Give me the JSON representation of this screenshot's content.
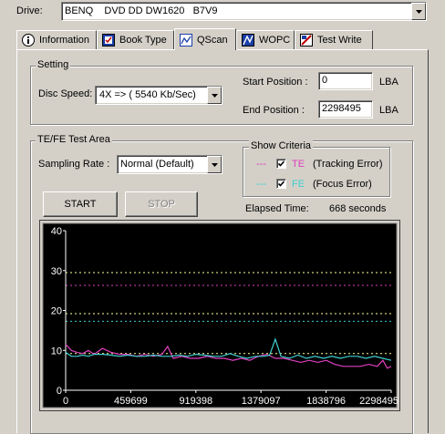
{
  "drive": {
    "label": "Drive:",
    "value": "BENQ    DVD DD DW1620   B7V9"
  },
  "tabs": [
    {
      "label": "Information",
      "icon": "info-icon"
    },
    {
      "label": "Book Type",
      "icon": "book-type-icon"
    },
    {
      "label": "QScan",
      "icon": "qscan-icon",
      "active": true
    },
    {
      "label": "WOPC",
      "icon": "wopc-icon"
    },
    {
      "label": "Test Write",
      "icon": "test-write-icon"
    }
  ],
  "setting": {
    "title": "Setting",
    "disc_speed_label": "Disc Speed:",
    "disc_speed_value": "4X => ( 5540 Kb/Sec)",
    "start_label": "Start Position :",
    "start_value": "0",
    "start_unit": "LBA",
    "end_label": "End Position :",
    "end_value": "2298495",
    "end_unit": "LBA"
  },
  "tefe": {
    "title": "TE/FE Test Area",
    "sampling_label": "Sampling Rate :",
    "sampling_value": "Normal (Default)",
    "show_criteria_title": "Show Criteria",
    "te_dash": "---",
    "te_abbr": "TE",
    "te_desc": "(Tracking Error)",
    "te_checked": true,
    "fe_dash": "---",
    "fe_abbr": "FE",
    "fe_desc": "(Focus Error)",
    "fe_checked": true,
    "start_button": "START",
    "stop_button": "STOP",
    "elapsed_label": "Elapsed Time:",
    "elapsed_value": "668 seconds"
  },
  "colors": {
    "te": "#e040c0",
    "fe": "#40d0d0",
    "plot_bg": "#000000",
    "threshold_white": "#ffff99"
  },
  "chart_data": {
    "type": "line",
    "title": "",
    "xlabel": "",
    "ylabel": "",
    "xlim": [
      0,
      2298495
    ],
    "ylim": [
      0,
      40
    ],
    "y_ticks": [
      "0",
      "10",
      "20",
      "30",
      "40"
    ],
    "x_ticks": [
      "0",
      "459699",
      "919398",
      "1379097",
      "1838796",
      "2298495"
    ],
    "x_tick_values": [
      0,
      459699,
      919398,
      1379097,
      1838796,
      2298495
    ],
    "threshold_lines": [
      {
        "color": "white",
        "y": 29.5
      },
      {
        "color": "te",
        "y": 26.3
      },
      {
        "color": "white",
        "y": 19.2
      },
      {
        "color": "fe",
        "y": 17.3
      },
      {
        "color": "white",
        "y": 9.2
      }
    ],
    "series": [
      {
        "key": "te",
        "x": [
          0,
          40000,
          80000,
          120000,
          160000,
          200000,
          260000,
          320000,
          380000,
          440000,
          500000,
          560000,
          620000,
          680000,
          720000,
          760000,
          820000,
          880000,
          940000,
          1000000,
          1060000,
          1120000,
          1180000,
          1240000,
          1300000,
          1360000,
          1420000,
          1480000,
          1540000,
          1600000,
          1660000,
          1720000,
          1780000,
          1840000,
          1900000,
          1960000,
          2020000,
          2080000,
          2140000,
          2200000,
          2240000,
          2270000,
          2298495
        ],
        "values": [
          11.5,
          10.0,
          9.5,
          9.2,
          10.0,
          9.0,
          10.5,
          9.5,
          9.0,
          9.0,
          8.5,
          9.0,
          8.5,
          9.0,
          11.0,
          8.0,
          8.5,
          8.0,
          8.0,
          8.5,
          8.0,
          8.0,
          7.5,
          8.0,
          7.5,
          8.5,
          9.0,
          8.0,
          8.0,
          7.5,
          7.0,
          7.5,
          7.0,
          7.5,
          6.5,
          6.0,
          6.0,
          6.0,
          6.5,
          6.0,
          7.5,
          5.5,
          6.0
        ]
      },
      {
        "key": "fe",
        "x": [
          0,
          40000,
          80000,
          120000,
          160000,
          200000,
          260000,
          320000,
          380000,
          440000,
          500000,
          560000,
          620000,
          680000,
          740000,
          800000,
          860000,
          920000,
          980000,
          1040000,
          1100000,
          1160000,
          1220000,
          1280000,
          1340000,
          1400000,
          1440000,
          1480000,
          1520000,
          1580000,
          1640000,
          1700000,
          1760000,
          1820000,
          1880000,
          1940000,
          2000000,
          2060000,
          2120000,
          2180000,
          2240000,
          2298495
        ],
        "values": [
          9.5,
          8.5,
          8.5,
          8.8,
          8.5,
          9.0,
          9.0,
          8.8,
          8.5,
          8.8,
          8.5,
          8.5,
          8.8,
          8.5,
          8.5,
          8.8,
          8.5,
          9.0,
          8.8,
          8.5,
          8.5,
          9.2,
          8.5,
          8.0,
          8.5,
          8.5,
          8.8,
          12.8,
          8.5,
          8.0,
          8.8,
          8.0,
          8.5,
          8.0,
          8.5,
          8.0,
          8.5,
          8.5,
          8.0,
          8.5,
          8.0,
          7.5
        ]
      }
    ]
  }
}
